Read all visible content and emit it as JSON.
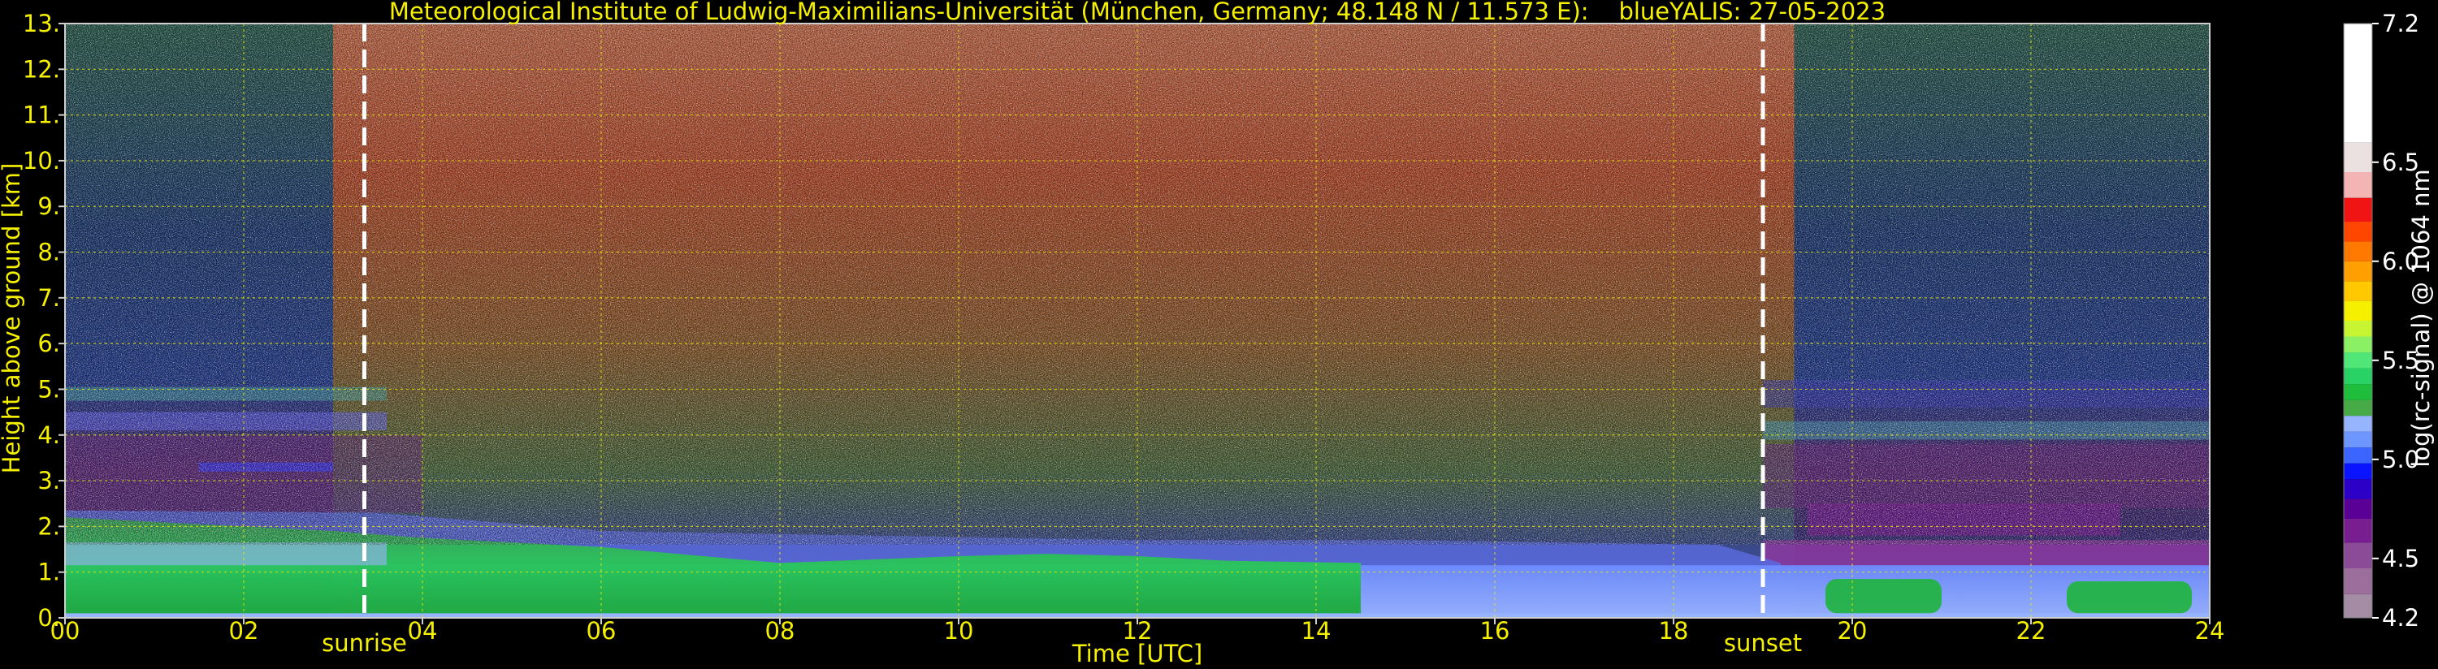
{
  "chart_data": {
    "type": "heatmap",
    "title": "Meteorological Institute of Ludwig-Maximilians-Universität (München, Germany; 48.148 N / 11.573 E):    blueYALIS: 27-05-2023",
    "xlabel": "Time [UTC]",
    "ylabel": "Height above ground [km]",
    "xlim": [
      0,
      24
    ],
    "ylim": [
      0,
      13
    ],
    "x_ticks": [
      {
        "value": 0,
        "label": "00"
      },
      {
        "value": 2,
        "label": "02"
      },
      {
        "value": 4,
        "label": "04"
      },
      {
        "value": 6,
        "label": "06"
      },
      {
        "value": 8,
        "label": "08"
      },
      {
        "value": 10,
        "label": "10"
      },
      {
        "value": 12,
        "label": "12"
      },
      {
        "value": 14,
        "label": "14"
      },
      {
        "value": 16,
        "label": "16"
      },
      {
        "value": 18,
        "label": "18"
      },
      {
        "value": 20,
        "label": "20"
      },
      {
        "value": 22,
        "label": "22"
      },
      {
        "value": 24,
        "label": "24"
      }
    ],
    "y_ticks": [
      {
        "value": 0,
        "label": "0."
      },
      {
        "value": 1,
        "label": "1."
      },
      {
        "value": 2,
        "label": "2."
      },
      {
        "value": 3,
        "label": "3."
      },
      {
        "value": 4,
        "label": "4."
      },
      {
        "value": 5,
        "label": "5."
      },
      {
        "value": 6,
        "label": "6."
      },
      {
        "value": 7,
        "label": "7."
      },
      {
        "value": 8,
        "label": "8."
      },
      {
        "value": 9,
        "label": "9."
      },
      {
        "value": 10,
        "label": "10."
      },
      {
        "value": 11,
        "label": "11."
      },
      {
        "value": 12,
        "label": "12."
      },
      {
        "value": 13,
        "label": "13."
      }
    ],
    "grid": true,
    "events": [
      {
        "label": "sunrise",
        "x": 3.35
      },
      {
        "label": "sunset",
        "x": 19.0
      }
    ],
    "colorbar": {
      "label": "log(rc-signal) @ 1064 nm",
      "range": [
        4.2,
        7.2
      ],
      "ticks": [
        {
          "value": 4.2,
          "label": "4.2"
        },
        {
          "value": 4.5,
          "label": "4.5"
        },
        {
          "value": 5.0,
          "label": "5.0"
        },
        {
          "value": 5.5,
          "label": "5.5"
        },
        {
          "value": 6.0,
          "label": "6.0"
        },
        {
          "value": 6.5,
          "label": "6.5"
        },
        {
          "value": 7.2,
          "label": "7.2"
        }
      ],
      "colors": [
        "#a58ca5",
        "#9b6e9b",
        "#8c4b96",
        "#781e91",
        "#5a0096",
        "#2d00c8",
        "#0a14ff",
        "#3c64ff",
        "#6e96ff",
        "#96b4ff",
        "#46aa46",
        "#1ebe3c",
        "#28d264",
        "#50e678",
        "#8cf064",
        "#c8f532",
        "#f5f000",
        "#ffc800",
        "#ffa000",
        "#ff7800",
        "#ff4600",
        "#f01414",
        "#f5b4b4",
        "#ebe1e1",
        "#ffffff"
      ],
      "stop_values": [
        4.2,
        4.32,
        4.45,
        4.58,
        4.7,
        4.8,
        4.9,
        4.98,
        5.06,
        5.14,
        5.22,
        5.3,
        5.38,
        5.46,
        5.54,
        5.62,
        5.7,
        5.8,
        5.9,
        6.0,
        6.1,
        6.2,
        6.32,
        6.45,
        6.6
      ]
    }
  }
}
